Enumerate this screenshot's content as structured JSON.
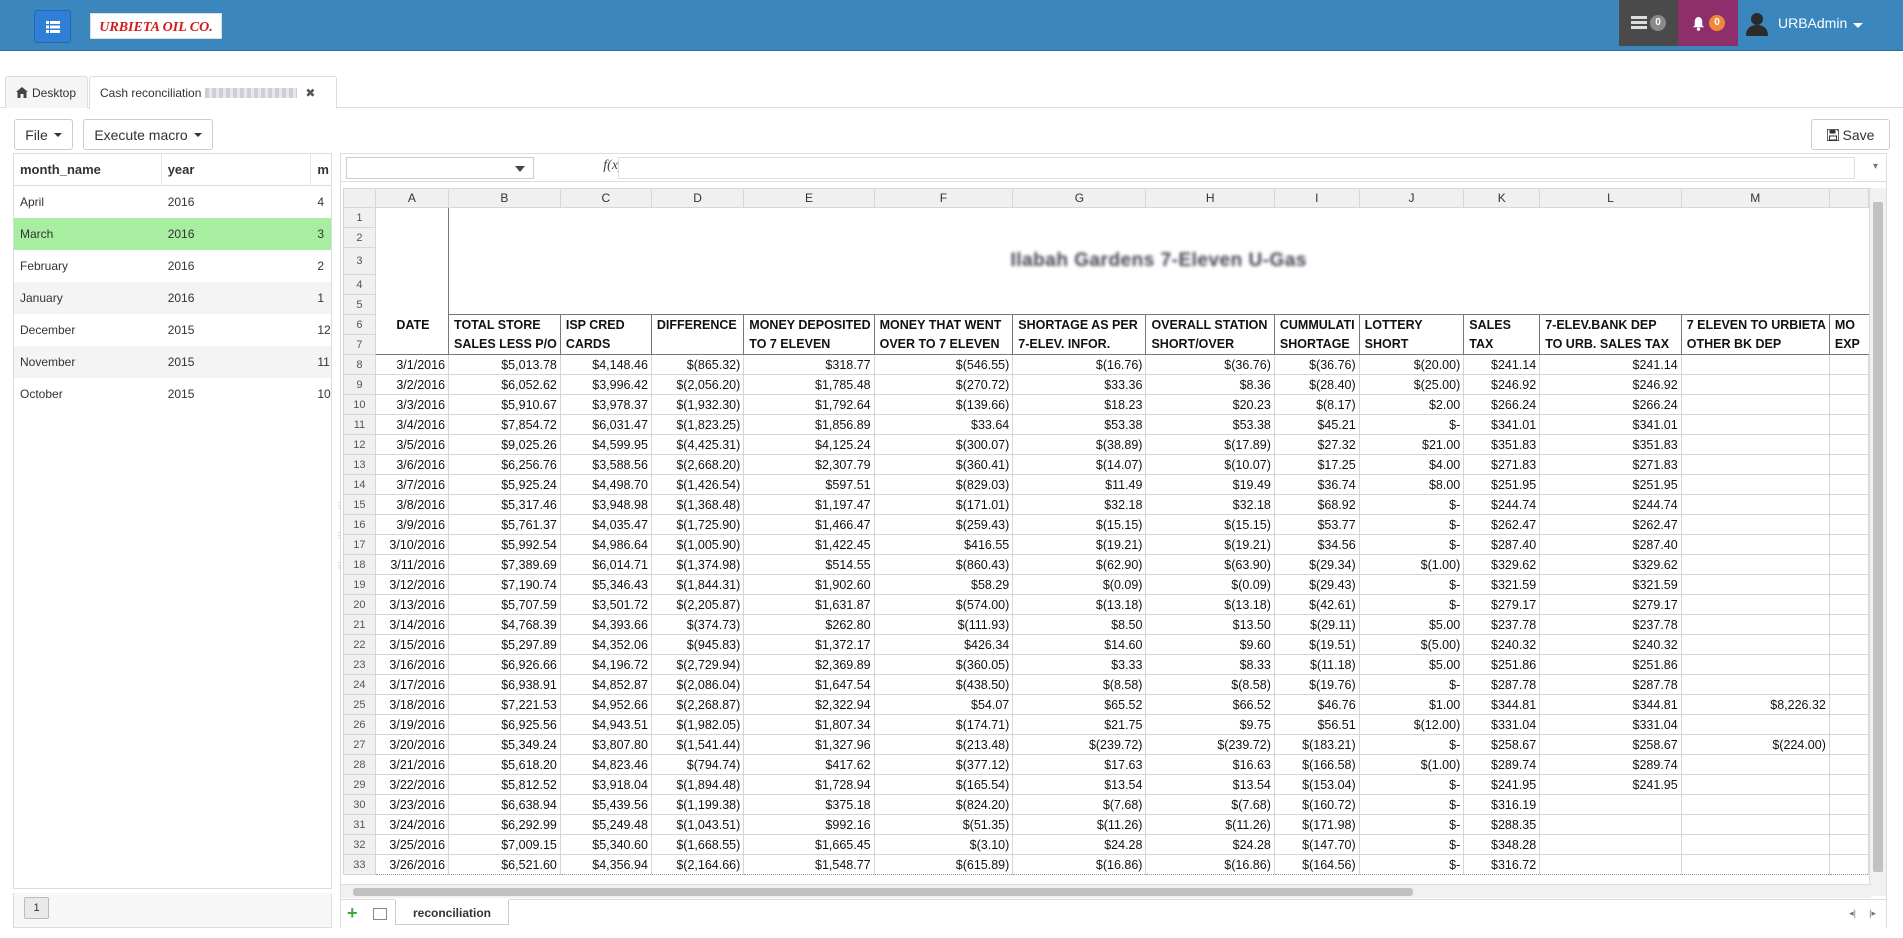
{
  "navbar": {
    "tasks_badge": "0",
    "notifications_badge": "0",
    "user_name": "URBAdmin"
  },
  "logo": {
    "text": "URBIETA OIL CO."
  },
  "tabs": [
    {
      "label": "Desktop"
    },
    {
      "label": "Cash reconciliation"
    }
  ],
  "toolbar": {
    "file_label": "File",
    "macro_label": "Execute macro",
    "save_label": "Save"
  },
  "left_grid": {
    "headers": [
      "month_name",
      "year",
      "m"
    ],
    "rows": [
      {
        "month": "April",
        "year": "2016",
        "m": "4"
      },
      {
        "month": "March",
        "year": "2016",
        "m": "3"
      },
      {
        "month": "February",
        "year": "2016",
        "m": "2"
      },
      {
        "month": "January",
        "year": "2016",
        "m": "1"
      },
      {
        "month": "December",
        "year": "2015",
        "m": "12"
      },
      {
        "month": "November",
        "year": "2015",
        "m": "11"
      },
      {
        "month": "October",
        "year": "2015",
        "m": "10"
      }
    ],
    "selected_index": 1,
    "page": "1"
  },
  "formula_bar": {
    "fx_label": "f(x)"
  },
  "sheet": {
    "col_letters": [
      "A",
      "B",
      "C",
      "D",
      "E",
      "F",
      "G",
      "H",
      "I",
      "J",
      "K",
      "L",
      "M"
    ],
    "title": "Ilabah Gardens 7-Eleven U-Gas",
    "headers_row6": [
      "DATE",
      "TOTAL STORE",
      "ISP CRED",
      "DIFFERENCE",
      "MONEY DEPOSITED",
      "MONEY THAT WENT",
      "SHORTAGE AS PER",
      "OVERALL STATION",
      "CUMMULATI",
      "LOTTERY",
      "SALES",
      "7-ELEV.BANK DEP",
      "7 ELEVEN TO URBIETA",
      "MO"
    ],
    "headers_row7": [
      "",
      "SALES LESS P/O",
      "CARDS",
      "",
      "TO 7 ELEVEN",
      "OVER TO 7 ELEVEN",
      "7-ELEV. INFOR.",
      "SHORT/OVER",
      "SHORTAGE",
      "SHORT",
      "TAX",
      "TO URB. SALES TAX",
      "OTHER BK DEP",
      "EXP"
    ],
    "rows": [
      [
        "3/1/2016",
        "$5,013.78",
        "$4,148.46",
        "$(865.32)",
        "$318.77",
        "$(546.55)",
        "$(16.76)",
        "$(36.76)",
        "$(36.76)",
        "$(20.00)",
        "$241.14",
        "$241.14",
        ""
      ],
      [
        "3/2/2016",
        "$6,052.62",
        "$3,996.42",
        "$(2,056.20)",
        "$1,785.48",
        "$(270.72)",
        "$33.36",
        "$8.36",
        "$(28.40)",
        "$(25.00)",
        "$246.92",
        "$246.92",
        ""
      ],
      [
        "3/3/2016",
        "$5,910.67",
        "$3,978.37",
        "$(1,932.30)",
        "$1,792.64",
        "$(139.66)",
        "$18.23",
        "$20.23",
        "$(8.17)",
        "$2.00",
        "$266.24",
        "$266.24",
        ""
      ],
      [
        "3/4/2016",
        "$7,854.72",
        "$6,031.47",
        "$(1,823.25)",
        "$1,856.89",
        "$33.64",
        "$53.38",
        "$53.38",
        "$45.21",
        "$-",
        "$341.01",
        "$341.01",
        ""
      ],
      [
        "3/5/2016",
        "$9,025.26",
        "$4,599.95",
        "$(4,425.31)",
        "$4,125.24",
        "$(300.07)",
        "$(38.89)",
        "$(17.89)",
        "$27.32",
        "$21.00",
        "$351.83",
        "$351.83",
        ""
      ],
      [
        "3/6/2016",
        "$6,256.76",
        "$3,588.56",
        "$(2,668.20)",
        "$2,307.79",
        "$(360.41)",
        "$(14.07)",
        "$(10.07)",
        "$17.25",
        "$4.00",
        "$271.83",
        "$271.83",
        ""
      ],
      [
        "3/7/2016",
        "$5,925.24",
        "$4,498.70",
        "$(1,426.54)",
        "$597.51",
        "$(829.03)",
        "$11.49",
        "$19.49",
        "$36.74",
        "$8.00",
        "$251.95",
        "$251.95",
        ""
      ],
      [
        "3/8/2016",
        "$5,317.46",
        "$3,948.98",
        "$(1,368.48)",
        "$1,197.47",
        "$(171.01)",
        "$32.18",
        "$32.18",
        "$68.92",
        "$-",
        "$244.74",
        "$244.74",
        ""
      ],
      [
        "3/9/2016",
        "$5,761.37",
        "$4,035.47",
        "$(1,725.90)",
        "$1,466.47",
        "$(259.43)",
        "$(15.15)",
        "$(15.15)",
        "$53.77",
        "$-",
        "$262.47",
        "$262.47",
        ""
      ],
      [
        "3/10/2016",
        "$5,992.54",
        "$4,986.64",
        "$(1,005.90)",
        "$1,422.45",
        "$416.55",
        "$(19.21)",
        "$(19.21)",
        "$34.56",
        "$-",
        "$287.40",
        "$287.40",
        ""
      ],
      [
        "3/11/2016",
        "$7,389.69",
        "$6,014.71",
        "$(1,374.98)",
        "$514.55",
        "$(860.43)",
        "$(62.90)",
        "$(63.90)",
        "$(29.34)",
        "$(1.00)",
        "$329.62",
        "$329.62",
        ""
      ],
      [
        "3/12/2016",
        "$7,190.74",
        "$5,346.43",
        "$(1,844.31)",
        "$1,902.60",
        "$58.29",
        "$(0.09)",
        "$(0.09)",
        "$(29.43)",
        "$-",
        "$321.59",
        "$321.59",
        ""
      ],
      [
        "3/13/2016",
        "$5,707.59",
        "$3,501.72",
        "$(2,205.87)",
        "$1,631.87",
        "$(574.00)",
        "$(13.18)",
        "$(13.18)",
        "$(42.61)",
        "$-",
        "$279.17",
        "$279.17",
        ""
      ],
      [
        "3/14/2016",
        "$4,768.39",
        "$4,393.66",
        "$(374.73)",
        "$262.80",
        "$(111.93)",
        "$8.50",
        "$13.50",
        "$(29.11)",
        "$5.00",
        "$237.78",
        "$237.78",
        ""
      ],
      [
        "3/15/2016",
        "$5,297.89",
        "$4,352.06",
        "$(945.83)",
        "$1,372.17",
        "$426.34",
        "$14.60",
        "$9.60",
        "$(19.51)",
        "$(5.00)",
        "$240.32",
        "$240.32",
        ""
      ],
      [
        "3/16/2016",
        "$6,926.66",
        "$4,196.72",
        "$(2,729.94)",
        "$2,369.89",
        "$(360.05)",
        "$3.33",
        "$8.33",
        "$(11.18)",
        "$5.00",
        "$251.86",
        "$251.86",
        ""
      ],
      [
        "3/17/2016",
        "$6,938.91",
        "$4,852.87",
        "$(2,086.04)",
        "$1,647.54",
        "$(438.50)",
        "$(8.58)",
        "$(8.58)",
        "$(19.76)",
        "$-",
        "$287.78",
        "$287.78",
        ""
      ],
      [
        "3/18/2016",
        "$7,221.53",
        "$4,952.66",
        "$(2,268.87)",
        "$2,322.94",
        "$54.07",
        "$65.52",
        "$66.52",
        "$46.76",
        "$1.00",
        "$344.81",
        "$344.81",
        "$8,226.32"
      ],
      [
        "3/19/2016",
        "$6,925.56",
        "$4,943.51",
        "$(1,982.05)",
        "$1,807.34",
        "$(174.71)",
        "$21.75",
        "$9.75",
        "$56.51",
        "$(12.00)",
        "$331.04",
        "$331.04",
        ""
      ],
      [
        "3/20/2016",
        "$5,349.24",
        "$3,807.80",
        "$(1,541.44)",
        "$1,327.96",
        "$(213.48)",
        "$(239.72)",
        "$(239.72)",
        "$(183.21)",
        "$-",
        "$258.67",
        "$258.67",
        "$(224.00)"
      ],
      [
        "3/21/2016",
        "$5,618.20",
        "$4,823.46",
        "$(794.74)",
        "$417.62",
        "$(377.12)",
        "$17.63",
        "$16.63",
        "$(166.58)",
        "$(1.00)",
        "$289.74",
        "$289.74",
        ""
      ],
      [
        "3/22/2016",
        "$5,812.52",
        "$3,918.04",
        "$(1,894.48)",
        "$1,728.94",
        "$(165.54)",
        "$13.54",
        "$13.54",
        "$(153.04)",
        "$-",
        "$241.95",
        "$241.95",
        ""
      ],
      [
        "3/23/2016",
        "$6,638.94",
        "$5,439.56",
        "$(1,199.38)",
        "$375.18",
        "$(824.20)",
        "$(7.68)",
        "$(7.68)",
        "$(160.72)",
        "$-",
        "$316.19",
        "",
        ""
      ],
      [
        "3/24/2016",
        "$6,292.99",
        "$5,249.48",
        "$(1,043.51)",
        "$992.16",
        "$(51.35)",
        "$(11.26)",
        "$(11.26)",
        "$(171.98)",
        "$-",
        "$288.35",
        "",
        ""
      ],
      [
        "3/25/2016",
        "$7,009.15",
        "$5,340.60",
        "$(1,668.55)",
        "$1,665.45",
        "$(3.10)",
        "$24.28",
        "$24.28",
        "$(147.70)",
        "$-",
        "$348.28",
        "",
        ""
      ],
      [
        "3/26/2016",
        "$6,521.60",
        "$4,356.94",
        "$(2,164.66)",
        "$1,548.77",
        "$(615.89)",
        "$(16.86)",
        "$(16.86)",
        "$(164.56)",
        "$-",
        "$316.72",
        "",
        ""
      ]
    ],
    "sheet_tab": "reconciliation"
  }
}
